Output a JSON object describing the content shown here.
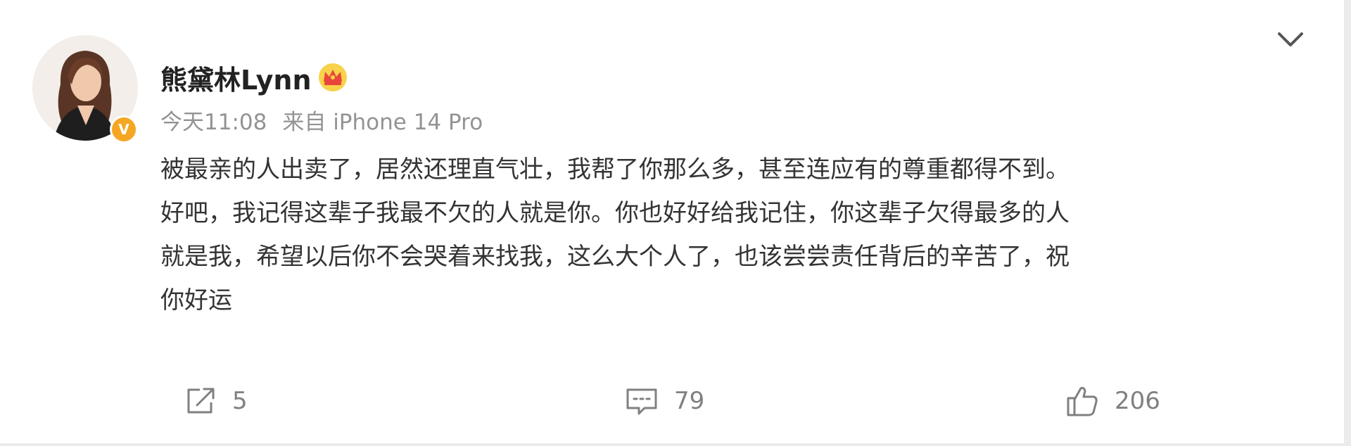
{
  "post": {
    "username": "熊黛林Lynn",
    "time": "今天11:08",
    "source": "来自 iPhone 14 Pro",
    "lines": [
      "被最亲的人出卖了，居然还理直气壮，我帮了你那么多，甚至连应有的尊重都得不到。",
      "好吧，我记得这辈子我最不欠的人就是你。你也好好给我记住，你这辈子欠得最多的人",
      "就是我，希望以后你不会哭着来找我，这么大个人了，也该尝尝责任背后的辛苦了，祝",
      "你好运"
    ]
  },
  "actions": {
    "repost_count": "5",
    "comment_count": "79",
    "like_count": "206"
  },
  "icons": {
    "menu": "chevron-down-icon",
    "badge": "verified-badge-icon",
    "member": "crown-icon",
    "repost": "repost-icon",
    "comment": "comment-icon",
    "like": "thumbs-up-icon"
  },
  "colors": {
    "verified": "#f5a623",
    "muted": "#939393",
    "text": "#333333",
    "username": "#222222"
  }
}
